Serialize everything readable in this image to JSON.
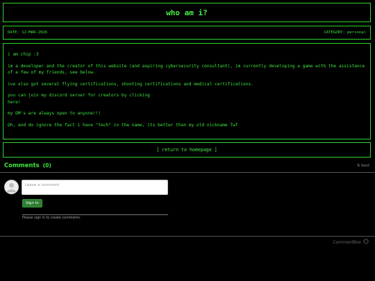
{
  "header": {
    "title": "who am i?"
  },
  "meta": {
    "date": "DATE: 12-MAR-2026",
    "category": "CATEGORY: personal"
  },
  "content": {
    "paragraphs": [
      "i am chip :3",
      "im a developer and the creator of this website (and aspiring cybersecurity consultant), im currently developing a game with the assistance of a few of my friends, see below.",
      "ive also got several flying certifications, shooting certifications and medical certifications.",
      "you can join my discord server for creators by clicking",
      "here!",
      "my DM's are always open to anyone!!!",
      "Oh, and do ignore the fact i have \"tech\" in the name, its better than my old nickname TwT"
    ]
  },
  "return_link": "[ return to homepage ]",
  "comments": {
    "title": "Comments",
    "count": "(0)",
    "sort_label": "⇅ best",
    "input_placeholder": "Leave a comment",
    "signin_label": "Sign In",
    "signin_note": "Please sign in to create comments.",
    "brand": "CommentBox"
  },
  "icons": {
    "avatar": "user-avatar-icon",
    "brand": "commentbox-logo-icon",
    "sort": "sort-icon"
  },
  "colors": {
    "accent": "#3fe43f",
    "background": "#000000",
    "signin": "#2e7d32"
  }
}
